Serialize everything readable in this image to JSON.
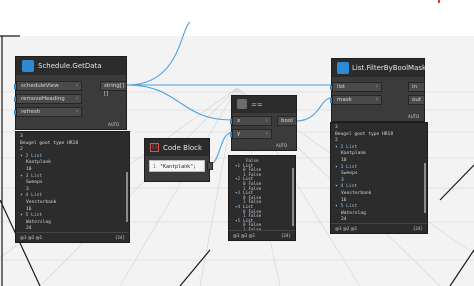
{
  "schedule_node": {
    "title": "Schedule.GetData",
    "inputs": [
      "scheduleView",
      "removeHeading",
      "refresh"
    ],
    "output": "string[][]",
    "lacing": "AUTO",
    "preview": {
      "rows": [
        {
          "indent": 0,
          "text": "3",
          "arrow": false
        },
        {
          "indent": 0,
          "text": "Beugel goot type HR18",
          "arrow": false
        },
        {
          "indent": 0,
          "text": "2",
          "arrow": false
        },
        {
          "indent": 0,
          "text": "2 List",
          "arrow": true
        },
        {
          "indent": 1,
          "text": "Kantplank",
          "arrow": false
        },
        {
          "indent": 1,
          "text": "10",
          "arrow": false
        },
        {
          "indent": 0,
          "text": "3 List",
          "arrow": true
        },
        {
          "indent": 1,
          "text": "Sweeps",
          "arrow": false
        },
        {
          "indent": 1,
          "text": "3",
          "arrow": false
        },
        {
          "indent": 0,
          "text": "4 List",
          "arrow": true
        },
        {
          "indent": 1,
          "text": "Vensterbank",
          "arrow": false
        },
        {
          "indent": 1,
          "text": "16",
          "arrow": false
        },
        {
          "indent": 0,
          "text": "5 List",
          "arrow": true
        },
        {
          "indent": 1,
          "text": "Waterslag",
          "arrow": false
        },
        {
          "indent": 1,
          "text": "24",
          "arrow": false
        }
      ],
      "levels": "@3 @2 @1",
      "count": "{24}"
    }
  },
  "code_block": {
    "title": "Code Block",
    "line_no": "1",
    "code": "\"Kantplank\";"
  },
  "equals_node": {
    "title": "==",
    "inputs": [
      "x",
      "y"
    ],
    "output": "bool",
    "lacing": "AUTO",
    "preview": {
      "rows": [
        {
          "text": "False",
          "arrow": false,
          "idx": ""
        },
        {
          "text": "List",
          "arrow": true,
          "idx": "1"
        },
        {
          "text": "False",
          "arrow": false,
          "idx": "0"
        },
        {
          "text": "False",
          "arrow": false,
          "idx": "1"
        },
        {
          "text": "List",
          "arrow": true,
          "idx": "2"
        },
        {
          "text": "False",
          "arrow": false,
          "idx": "0"
        },
        {
          "text": "False",
          "arrow": false,
          "idx": "1"
        },
        {
          "text": "List",
          "arrow": true,
          "idx": "3"
        },
        {
          "text": "False",
          "arrow": false,
          "idx": "0"
        },
        {
          "text": "False",
          "arrow": false,
          "idx": "1"
        },
        {
          "text": "List",
          "arrow": true,
          "idx": "4"
        },
        {
          "text": "False",
          "arrow": false,
          "idx": "0"
        },
        {
          "text": "False",
          "arrow": false,
          "idx": "1"
        },
        {
          "text": "List",
          "arrow": true,
          "idx": "5"
        },
        {
          "text": "False",
          "arrow": false,
          "idx": "0"
        },
        {
          "text": "False",
          "arrow": false,
          "idx": "1"
        }
      ],
      "levels": "@3 @2 @1",
      "count": "{24}"
    }
  },
  "filter_node": {
    "title": "List.FilterByBoolMask",
    "inputs": [
      "list",
      "mask"
    ],
    "outputs": [
      "in",
      "out"
    ],
    "lacing": "AUTO",
    "preview": {
      "rows": [
        {
          "indent": 0,
          "text": "3",
          "arrow": false
        },
        {
          "indent": 0,
          "text": "Beugel goot type HR18",
          "arrow": false
        },
        {
          "indent": 0,
          "text": "2",
          "arrow": false
        },
        {
          "indent": 0,
          "text": "2 List",
          "arrow": true
        },
        {
          "indent": 1,
          "text": "Kantplank",
          "arrow": false
        },
        {
          "indent": 1,
          "text": "10",
          "arrow": false
        },
        {
          "indent": 0,
          "text": "3 List",
          "arrow": true
        },
        {
          "indent": 1,
          "text": "Sweeps",
          "arrow": false
        },
        {
          "indent": 1,
          "text": "3",
          "arrow": false
        },
        {
          "indent": 0,
          "text": "4 List",
          "arrow": true
        },
        {
          "indent": 1,
          "text": "Vensterbank",
          "arrow": false
        },
        {
          "indent": 1,
          "text": "16",
          "arrow": false
        },
        {
          "indent": 0,
          "text": "5 List",
          "arrow": true
        },
        {
          "indent": 1,
          "text": "Waterslag",
          "arrow": false
        },
        {
          "indent": 1,
          "text": "24",
          "arrow": false
        }
      ],
      "levels": "@3 @2 @1",
      "count": "{24}"
    }
  },
  "colors": {
    "node_body": "#3b3b3b",
    "node_header": "#2b2b2b",
    "wire": "#4aa3df",
    "accent_blue": "#2d8bd6",
    "grid": "#cfcfcf",
    "code_icon": "#d9534f"
  }
}
